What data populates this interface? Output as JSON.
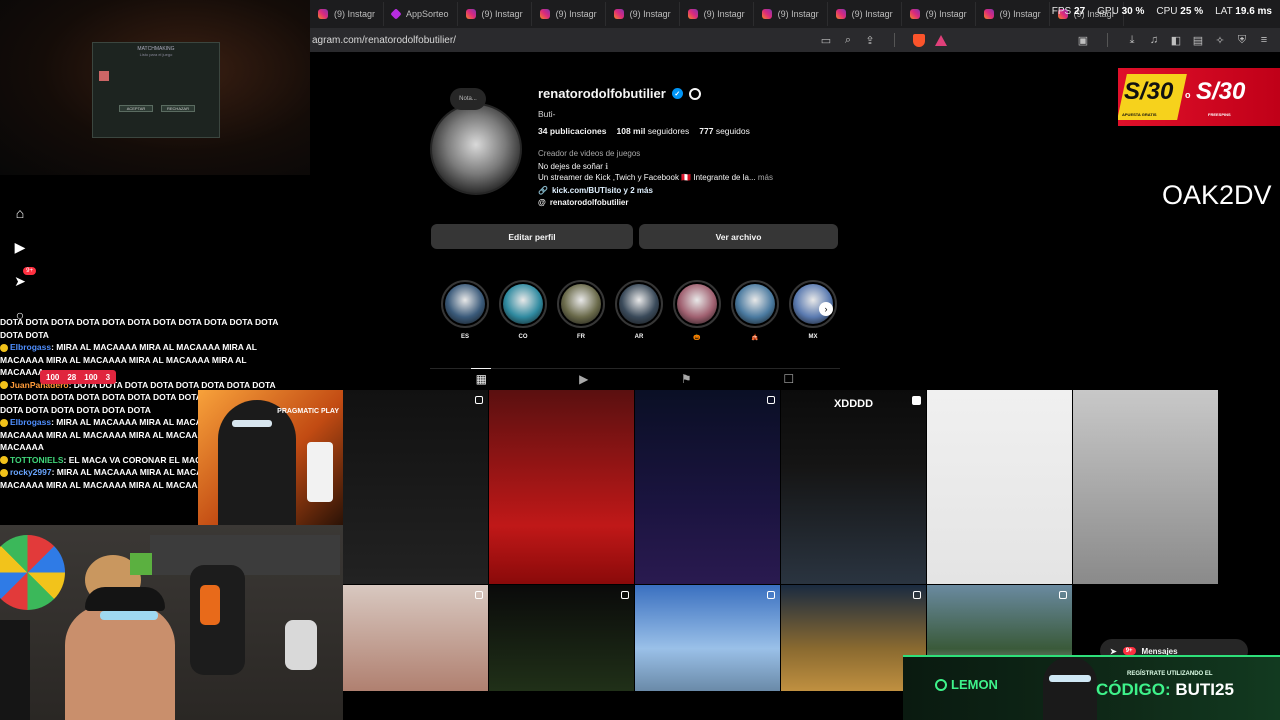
{
  "browser": {
    "tabs": [
      {
        "label": "(9) Instagr",
        "icon": "instagram-icon"
      },
      {
        "label": "AppSorteo",
        "icon": "appsorteo-icon"
      },
      {
        "label": "(9) Instagr",
        "icon": "instagram-icon"
      },
      {
        "label": "(9) Instagr",
        "icon": "instagram-icon"
      },
      {
        "label": "(9) Instagr",
        "icon": "instagram-icon"
      },
      {
        "label": "(9) Instagr",
        "icon": "instagram-icon"
      },
      {
        "label": "(9) Instagr",
        "icon": "instagram-icon"
      },
      {
        "label": "(9) Instagr",
        "icon": "instagram-icon"
      },
      {
        "label": "(9) Instagr",
        "icon": "instagram-icon"
      },
      {
        "label": "(9) Instagr",
        "icon": "instagram-icon"
      },
      {
        "label": "(9) Instagr",
        "icon": "instagram-icon"
      }
    ],
    "url": "agram.com/renatorodolfobutilier/"
  },
  "perf": {
    "fps_label": "FPS",
    "fps": "27",
    "gpu_label": "GPU",
    "gpu": "30 %",
    "cpu_label": "CPU",
    "cpu": "25 %",
    "lat_label": "LAT",
    "lat": "19.6 ms"
  },
  "profile": {
    "note": "Nota...",
    "username": "renatorodolfobutilier",
    "full_name": "Buti-",
    "posts": "34 publicaciones",
    "followers_count": "108 mil",
    "followers_label": " seguidores",
    "following_count": "777",
    "following_label": " seguidos",
    "category": "Creador de videos de juegos",
    "bio_line1": "No dejes de soñar",
    "bio_line2": "Un streamer de Kick ,Twich y Facebook 🇵🇪 Integrante de la...",
    "bio_more": "más",
    "link": "kick.com/BUTIsito y 2 más",
    "threads": "renatorodolfobutilier",
    "edit_button": "Editar perfil",
    "archive_button": "Ver archivo"
  },
  "highlights": [
    {
      "label": "ES",
      "color": "#3a5a7a"
    },
    {
      "label": "CO",
      "color": "#2f8aa0"
    },
    {
      "label": "FR",
      "color": "#6a6a4a"
    },
    {
      "label": "AR",
      "color": "#3a4a5a"
    },
    {
      "label": "🎃",
      "color": "#a06070"
    },
    {
      "label": "🎪",
      "color": "#4a7aa0"
    },
    {
      "label": "MX",
      "color": "#5a7ab0"
    }
  ],
  "tabs": [
    "grid-icon",
    "reels-icon",
    "saved-icon",
    "tagged-icon"
  ],
  "posts": [
    {
      "bg": "linear-gradient(180deg,#111 0%,#222 100%)",
      "icon": "multi",
      "caption": ""
    },
    {
      "bg": "linear-gradient(180deg,#5a1010 0%,#c01818 70%,#8a0a0a 100%)",
      "icon": "",
      "caption": ""
    },
    {
      "bg": "linear-gradient(180deg,#0a0f25 0%,#1b1440 60%,#2a1a50 100%)",
      "icon": "multi",
      "caption": ""
    },
    {
      "bg": "linear-gradient(180deg,#0b0b0b 0%,#151515 40%,#2a3440 100%)",
      "icon": "play",
      "caption": "XDDDD"
    },
    {
      "bg": "linear-gradient(180deg,#f0f0f0 0%,#e4e4e4 100%)",
      "icon": "",
      "caption": ""
    },
    {
      "bg": "linear-gradient(180deg,#c8c8c8 0%,#8a8a8a 100%)",
      "icon": "",
      "caption": ""
    },
    {
      "bg": "linear-gradient(180deg,#d8c8c0 0%,#b08070 100%)",
      "icon": "multi",
      "caption": ""
    },
    {
      "bg": "linear-gradient(180deg,#0a0a0a 0%,#203018 100%)",
      "icon": "multi",
      "caption": ""
    },
    {
      "bg": "linear-gradient(180deg,#3a70c0 0%,#9ac0e8 60%,#6a8aa8 100%)",
      "icon": "multi",
      "caption": ""
    },
    {
      "bg": "linear-gradient(180deg,#1a2a40 0%,#8a6a30 60%,#c09040 100%)",
      "icon": "multi",
      "caption": ""
    },
    {
      "bg": "linear-gradient(180deg,#6a8aa0 0%,#3a5a3a 60%,#d0d0d0 100%)",
      "icon": "multi",
      "caption": ""
    }
  ],
  "messages": {
    "label": "Mensajes",
    "badge": "9+"
  },
  "nav_badge": "9+",
  "chat": {
    "stats": [
      "100",
      "28",
      "100",
      "3"
    ],
    "lines": [
      {
        "user": "",
        "text": "DOTA DOTA DOTA DOTA DOTA DOTA DOTA DOTA DOTA DOTA DOTA DOTA DOTA"
      },
      {
        "user": "Elbrogass",
        "text": ": MIRA AL MACAAAA   MIRA AL MACAAAA   MIRA AL MACAAAA   MIRA AL MACAAAA   MIRA AL MACAAAA   MIRA AL MACAAAA"
      },
      {
        "user": "JuanPanadero",
        "text": ": DOTA DOTA DOTA DOTA DOTA DOTA DOTA DOTA DOTA DOTA DOTA DOTA DOTA DOTA DOTA DOTA DOTA DOTA DOTA DOTA DOTA DOTA DOTA DOTA DOTA"
      },
      {
        "user": "Elbrogass",
        "text": ": MIRA AL MACAAAA   MIRA AL MACAAAA   MIRA AL MACAAAA   MIRA AL MACAAAA   MIRA AL MACAAAA   MIRA AL MACAAAA"
      },
      {
        "user": "TOTTONIELS",
        "text": ": EL MACA VA CORONAR          EL MACA VA CORONAR"
      },
      {
        "user": "rocky2997",
        "text": ": MIRA AL MACAAAA   MIRA AL MACAAAA   MIRA AL MACAAAA   MIRA AL MACAAAA   MIRA AL MACAAAA"
      }
    ]
  },
  "overlays": {
    "sponsor_brand": "PRAGMATIC PLAY",
    "promo_amount_1": "S/30",
    "promo_or": "o",
    "promo_amount_2": "S/30",
    "promo_sub_1": "APUESTA GRATIS",
    "promo_sub_2": "FREESPINS",
    "oak_text": "OAK2DV",
    "lemon_logo": "LEMON",
    "lemon_small": "REGÍSTRATE UTILIZANDO EL",
    "lemon_code_label": "CÓDIGO:",
    "lemon_code": "BUTI25",
    "dialog_title": "MATCHMAKING",
    "dialog_sub": "Listo para el juego",
    "dialog_accept": "ACEPTAR",
    "dialog_decline": "RECHAZAR"
  }
}
